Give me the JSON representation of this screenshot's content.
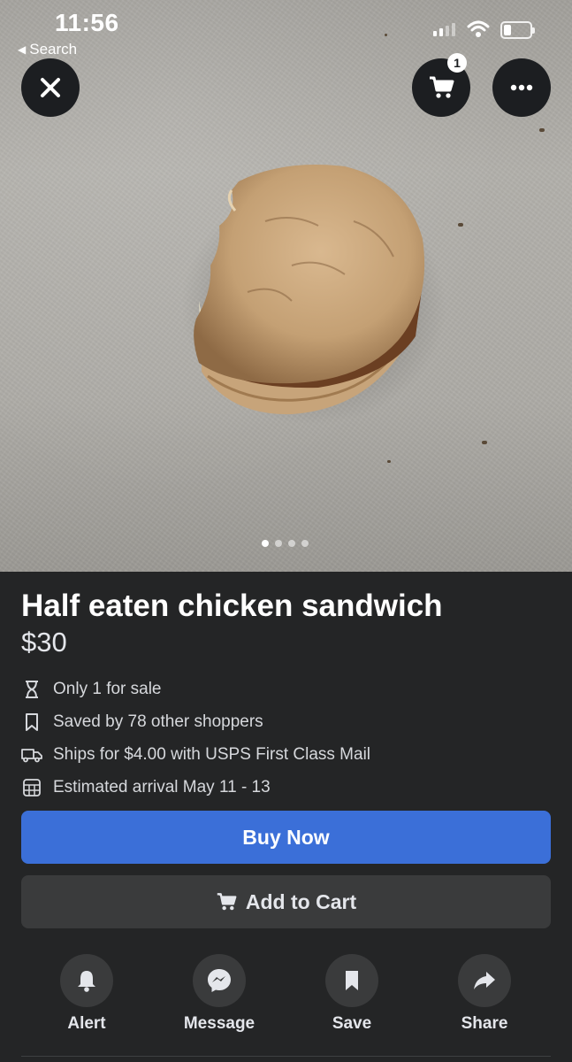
{
  "status_bar": {
    "time": "11:56",
    "back_label": "Search"
  },
  "header": {
    "cart_count": "1"
  },
  "gallery": {
    "photo_count": 4,
    "active_index": 0
  },
  "listing": {
    "title": "Half eaten chicken sandwich",
    "price": "$30",
    "details": [
      {
        "icon": "hourglass-icon",
        "text": "Only 1 for sale"
      },
      {
        "icon": "bookmark-icon",
        "text": "Saved by 78 other shoppers"
      },
      {
        "icon": "truck-icon",
        "text": "Ships for $4.00 with USPS First Class Mail"
      },
      {
        "icon": "calendar-icon",
        "text": "Estimated arrival May 11 - 13"
      }
    ]
  },
  "buttons": {
    "buy_now": "Buy Now",
    "add_to_cart": "Add to Cart"
  },
  "actions": [
    {
      "icon": "bell-icon",
      "label": "Alert"
    },
    {
      "icon": "messenger-icon",
      "label": "Message"
    },
    {
      "icon": "bookmark-icon",
      "label": "Save"
    },
    {
      "icon": "share-arrow-icon",
      "label": "Share"
    }
  ],
  "colors": {
    "accent": "#3b6fd8",
    "background": "#242526",
    "button_dark": "#3a3b3c"
  }
}
